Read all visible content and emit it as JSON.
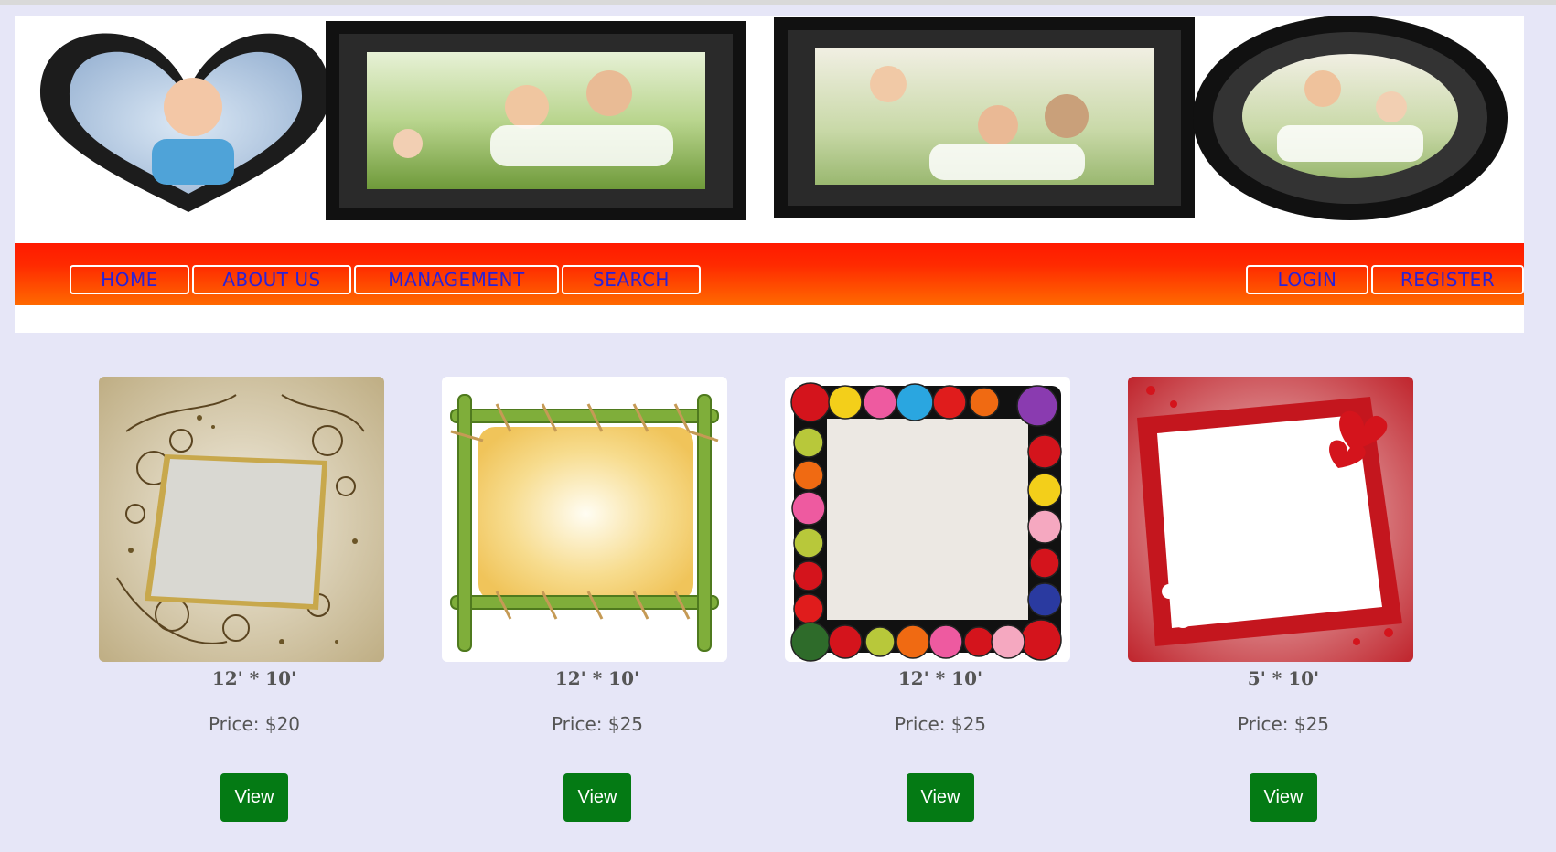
{
  "nav": {
    "left": [
      "HOME",
      "ABOUT US",
      "MANAGEMENT",
      "SEARCH"
    ],
    "right": [
      "LOGIN",
      "REGISTER"
    ]
  },
  "products": [
    {
      "size": "12' * 10'",
      "price": "Price: $20",
      "view": "View"
    },
    {
      "size": "12' * 10'",
      "price": "Price: $25",
      "view": "View"
    },
    {
      "size": "12' * 10'",
      "price": "Price: $25",
      "view": "View"
    },
    {
      "size": "5' * 10'",
      "price": "Price: $25",
      "view": "View"
    }
  ],
  "colors": {
    "page_bg": "#e6e6f7",
    "nav_gradient_top": "#ff1a00",
    "nav_gradient_bottom": "#ff6a00",
    "nav_text": "#2b22d6",
    "view_button": "#047a14"
  }
}
